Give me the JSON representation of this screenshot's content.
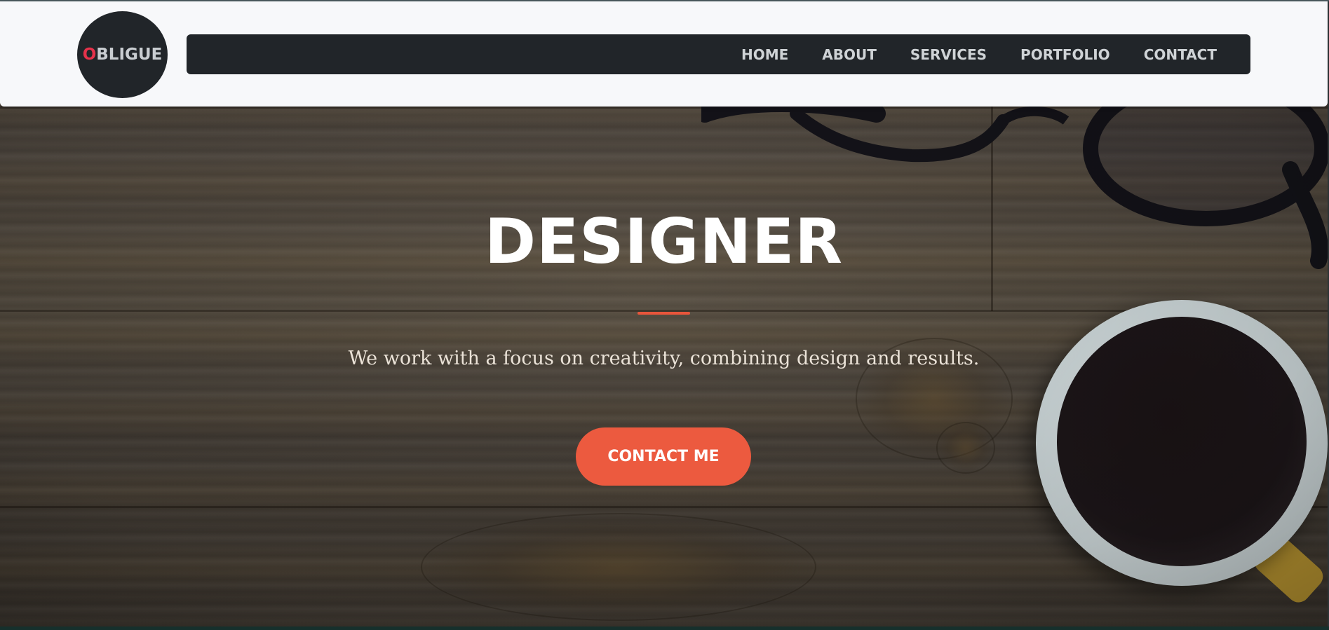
{
  "brand": {
    "logo_first_letter": "O",
    "logo_rest": "BLIGUE",
    "accent_color": "#e6324b"
  },
  "nav": {
    "items": [
      {
        "label": "HOME"
      },
      {
        "label": "ABOUT"
      },
      {
        "label": "SERVICES"
      },
      {
        "label": "PORTFOLIO"
      },
      {
        "label": "CONTACT"
      }
    ]
  },
  "hero": {
    "title": "DESIGNER",
    "subtitle": "We work with a focus on creativity, combining design and results.",
    "cta_label": "CONTACT ME",
    "cta_color": "#ec5a3f",
    "divider_color": "#e8553b",
    "background_image": "wood-desk-glasses-coffee"
  }
}
